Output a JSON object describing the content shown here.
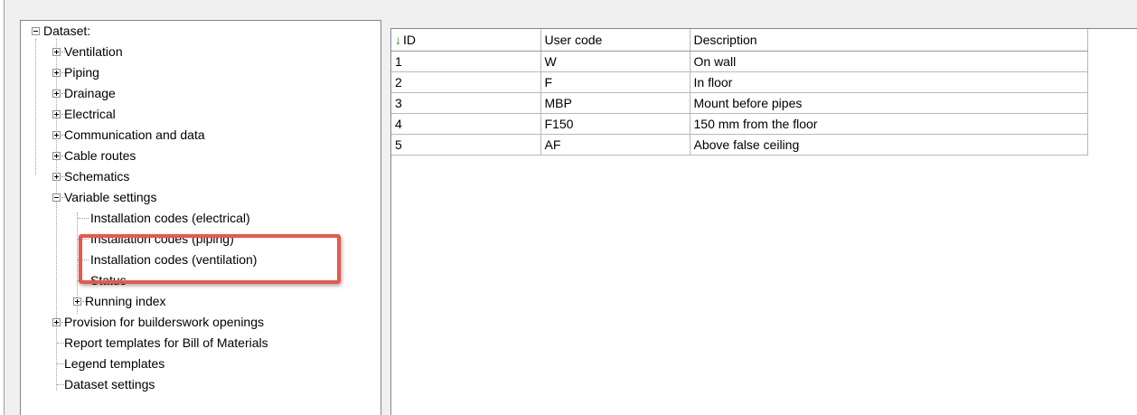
{
  "tree": {
    "root_label": "Dataset:",
    "items": [
      {
        "label": "Ventilation"
      },
      {
        "label": "Piping"
      },
      {
        "label": "Drainage"
      },
      {
        "label": "Electrical"
      },
      {
        "label": "Communication and data"
      },
      {
        "label": "Cable routes"
      },
      {
        "label": "Schematics"
      },
      {
        "label": "Variable settings"
      },
      {
        "label": "Provision for builderswork openings"
      },
      {
        "label": "Report templates for Bill of Materials"
      },
      {
        "label": "Legend templates"
      },
      {
        "label": "Dataset settings"
      }
    ],
    "variable_settings_children": [
      {
        "label": "Installation codes (electrical)"
      },
      {
        "label": "Installation codes (piping)"
      },
      {
        "label": "Installation codes (ventilation)"
      },
      {
        "label": "Status"
      },
      {
        "label": "Running index"
      }
    ]
  },
  "grid": {
    "columns": [
      {
        "label": "ID",
        "sort_icon": "sort-descending-arrow"
      },
      {
        "label": "User code"
      },
      {
        "label": "Description"
      }
    ],
    "rows": [
      {
        "id": "1",
        "code": "W",
        "description": "On wall"
      },
      {
        "id": "2",
        "code": "F",
        "description": "In floor"
      },
      {
        "id": "3",
        "code": "MBP",
        "description": "Mount before pipes"
      },
      {
        "id": "4",
        "code": "F150",
        "description": "150 mm from the floor"
      },
      {
        "id": "5",
        "code": "AF",
        "description": "Above false ceiling"
      }
    ]
  },
  "colors": {
    "highlight_border": "#e8584d",
    "sort_arrow": "#2a8a2a"
  }
}
